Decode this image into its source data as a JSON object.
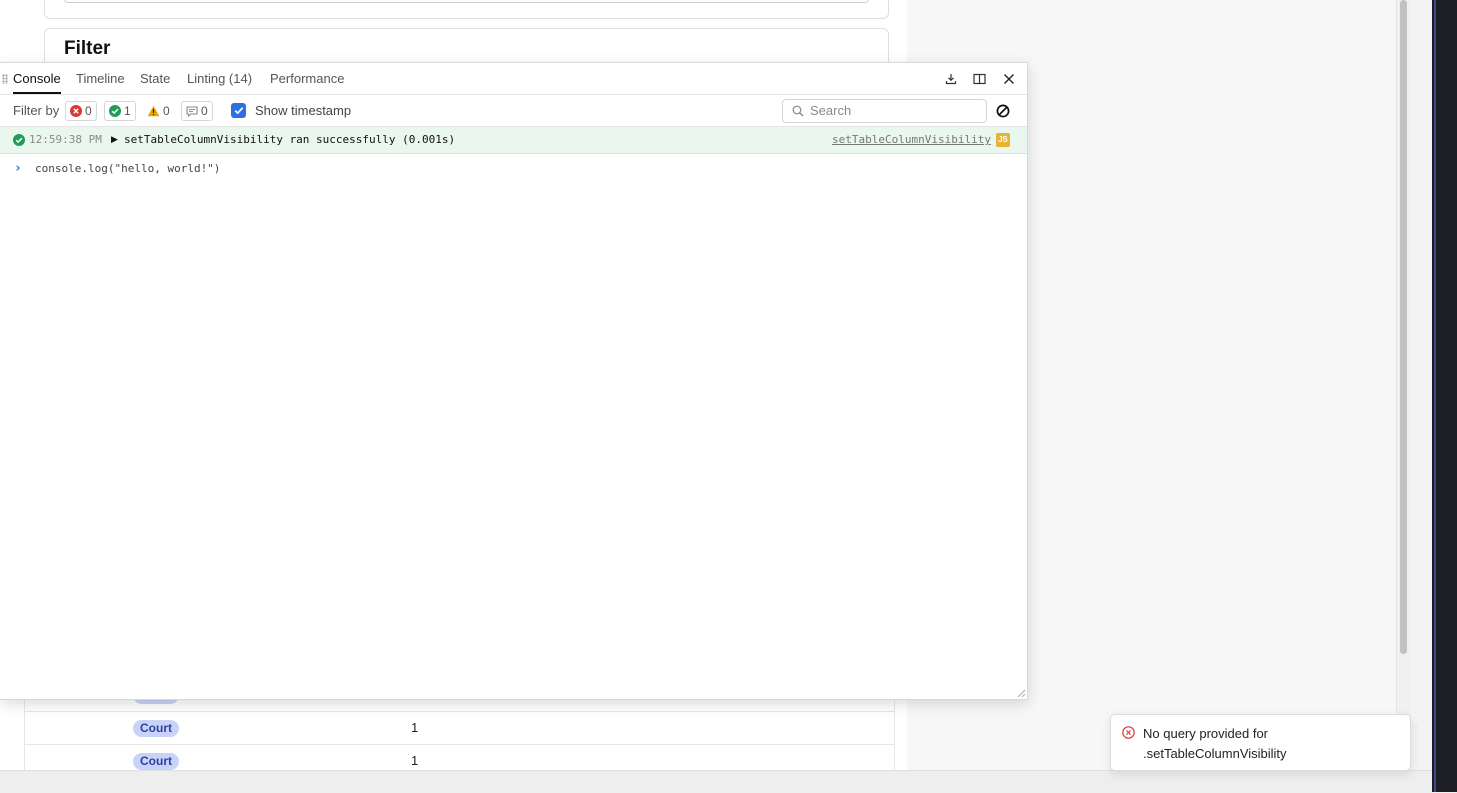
{
  "background": {
    "section_title": "Filter",
    "table_rows": [
      {
        "tag": "Court",
        "value": "1"
      },
      {
        "tag": "Court",
        "value": "1"
      }
    ]
  },
  "console": {
    "tabs": [
      {
        "label": "Console",
        "active": true
      },
      {
        "label": "Timeline",
        "active": false
      },
      {
        "label": "State",
        "active": false
      },
      {
        "label": "Linting (14)",
        "active": false
      },
      {
        "label": "Performance",
        "active": false
      }
    ],
    "actions": [
      "download-icon",
      "dock-side-icon",
      "close-icon"
    ],
    "filter": {
      "label": "Filter by",
      "error_count": "0",
      "success_count": "1",
      "warning_count": "0",
      "info_count": "0",
      "show_timestamp_label": "Show timestamp",
      "show_timestamp_checked": true,
      "search_placeholder": "Search"
    },
    "log_entry": {
      "timestamp": "12:59:38 PM",
      "message": "setTableColumnVisibility ran successfully (0.001s)",
      "source": "setTableColumnVisibility",
      "source_badge": "JS",
      "status": "success"
    },
    "repl_input": "console.log(\"hello, world!\")"
  },
  "toast": {
    "message": "No query provided for .setTableColumnVisibility",
    "status": "error"
  },
  "colors": {
    "accent": "#2f6fdf",
    "success": "#1f9d55",
    "error": "#d93838",
    "warning": "#e6a700",
    "tag_bg": "#c9d3f7",
    "js_badge": "#e6b336"
  }
}
